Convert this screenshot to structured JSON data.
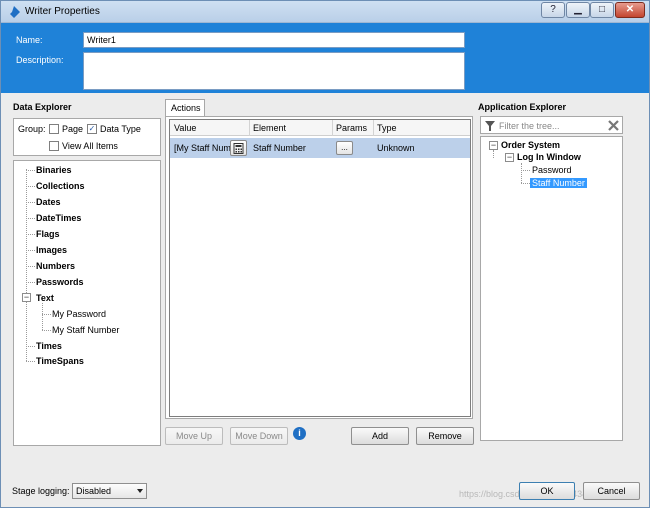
{
  "window": {
    "title": "Writer Properties"
  },
  "title_buttons": {
    "help": "?",
    "minimize": "▁",
    "maximize": "□",
    "close": "✕"
  },
  "header": {
    "name_label": "Name:",
    "name_value": "Writer1",
    "description_label": "Description:",
    "description_value": ""
  },
  "data_explorer": {
    "title": "Data Explorer",
    "group_label": "Group:",
    "page_label": "Page",
    "page_checked": false,
    "data_type_label": "Data Type",
    "data_type_checked": true,
    "view_all_label": "View All Items",
    "view_all_checked": false,
    "tree": [
      "Binaries",
      "Collections",
      "Dates",
      "DateTimes",
      "Flags",
      "Images",
      "Numbers",
      "Passwords",
      "Text",
      "My Password",
      "My Staff Number",
      "Times",
      "TimeSpans"
    ]
  },
  "actions": {
    "tab_label": "Actions",
    "columns": [
      "Value",
      "Element",
      "Params",
      "Type"
    ],
    "rows": [
      {
        "value": "[My Staff Num",
        "element": "Staff Number",
        "params_button": "...",
        "type": "Unknown"
      }
    ],
    "buttons": {
      "move_up": "Move Up",
      "move_down": "Move Down",
      "add": "Add",
      "remove": "Remove"
    }
  },
  "application_explorer": {
    "title": "Application Explorer",
    "filter_placeholder": "Filter the tree...",
    "tree": [
      "Order System",
      "Log In Window",
      "Password",
      "Staff Number"
    ],
    "selected": "Staff Number"
  },
  "footer": {
    "stage_logging_label": "Stage logging:",
    "stage_logging_value": "Disabled",
    "ok": "OK",
    "cancel": "Cancel",
    "watermark": "https://blog.csdn.net/weixin_43460032"
  },
  "colors": {
    "header_blue": "#1f82d8",
    "selection": "#3399ff",
    "row_highlight": "#bcd0ea"
  }
}
